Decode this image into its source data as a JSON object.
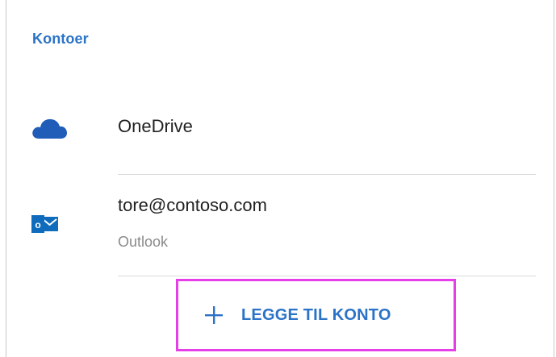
{
  "section": {
    "title": "Kontoer"
  },
  "accounts": [
    {
      "icon": "onedrive-cloud-icon",
      "name": "OneDrive",
      "service": ""
    },
    {
      "icon": "outlook-icon",
      "name": "tore@contoso.com",
      "service": "Outlook"
    }
  ],
  "actions": {
    "add_account_label": "LEGGE TIL KONTO",
    "add_icon": "plus-icon"
  },
  "colors": {
    "accent": "#2b73c7",
    "highlight": "#e63fe8",
    "onedrive": "#1f5db8",
    "outlook": "#0f6cbd"
  }
}
